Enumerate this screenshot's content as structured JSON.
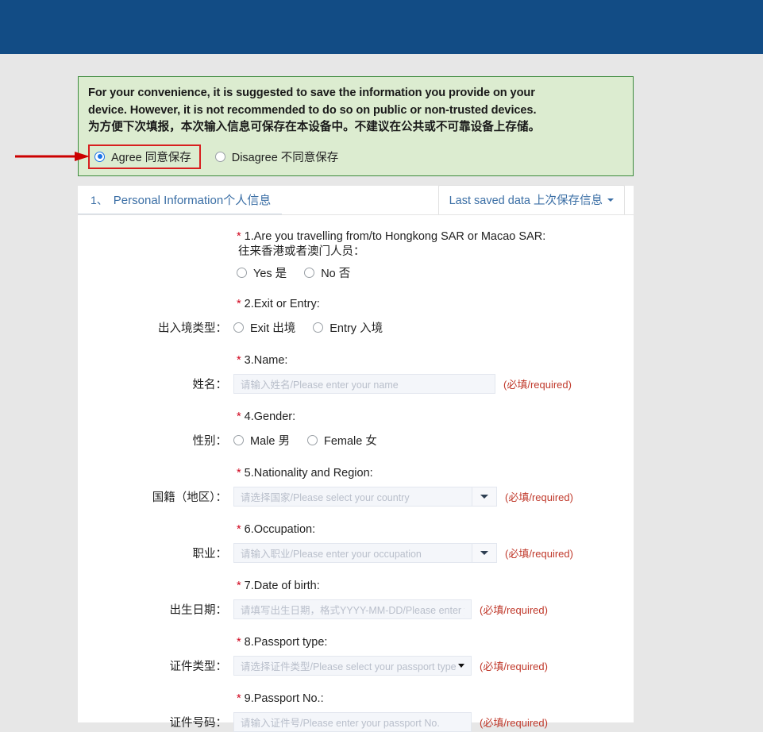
{
  "page": {
    "topbar_color": "#124c85",
    "background_color": "#e7e7e7"
  },
  "notice": {
    "line1_en": "For your convenience, it is suggested to save the information you provide on your",
    "line2_en": "device. However, it is not recommended to do so on public or non-trusted devices.",
    "line3_cn": "为方便下次填报，本次输入信息可保存在本设备中。不建议在公共或不可靠设备上存储。",
    "agree_label": "Agree 同意保存",
    "disagree_label": "Disagree 不同意保存",
    "agree_selected": true,
    "highlight_color": "#d81f1f",
    "box_bg": "#dcecd0",
    "box_border": "#3d8b3d"
  },
  "annotations": {
    "arrow_color": "#cc0000",
    "horizontal_arrow_target": "Agree 同意保存",
    "vertical_arrow_target": "form questions"
  },
  "panel": {
    "tab_number": "1、",
    "tab_label": "Personal Information个人信息",
    "last_saved_label": "Last saved data 上次保存信息",
    "accent_color": "#3a6ea5"
  },
  "questions": [
    {
      "id": "q1",
      "title_en": "1.Are you travelling from/to Hongkong SAR or Macao SAR:",
      "title_cn": "往来香港或者澳门人员：",
      "required": true,
      "type": "radio",
      "options": [
        "Yes 是",
        "No 否"
      ],
      "selected": null
    },
    {
      "id": "q2",
      "title_en": "2.Exit or Entry:",
      "title_cn": null,
      "label_cn": "出入境类型：",
      "required": true,
      "type": "radio-inline",
      "options": [
        "Exit 出境",
        "Entry 入境"
      ],
      "selected": null
    },
    {
      "id": "q3",
      "title_en": "3.Name:",
      "label_cn": "姓名：",
      "required": true,
      "type": "text",
      "placeholder": "请输入姓名/Please enter your name",
      "value": "",
      "required_hint": "(必填/required)"
    },
    {
      "id": "q4",
      "title_en": "4.Gender:",
      "label_cn": "性别：",
      "required": true,
      "type": "radio-inline",
      "options": [
        "Male 男",
        "Female 女"
      ],
      "selected": null
    },
    {
      "id": "q5",
      "title_en": "5.Nationality and Region:",
      "label_cn": "国籍（地区）：",
      "required": true,
      "type": "select",
      "placeholder": "请选择国家/Please select your country",
      "value": "",
      "required_hint": "(必填/required)"
    },
    {
      "id": "q6",
      "title_en": "6.Occupation:",
      "label_cn": "职业：",
      "required": true,
      "type": "select",
      "placeholder": "请输入职业/Please enter your occupation",
      "value": "",
      "required_hint": "(必填/required)"
    },
    {
      "id": "q7",
      "title_en": "7.Date of birth:",
      "label_cn": "出生日期：",
      "required": true,
      "type": "text",
      "placeholder": "请填写出生日期，格式YYYY-MM-DD/Please enter your",
      "value": "",
      "required_hint": "(必填/required)"
    },
    {
      "id": "q8",
      "title_en": "8.Passport type:",
      "label_cn": "证件类型：",
      "required": true,
      "type": "select-inline",
      "placeholder": "请选择证件类型/Please select your passport type",
      "value": "",
      "required_hint": "(必填/required)"
    },
    {
      "id": "q9",
      "title_en": "9.Passport No.:",
      "label_cn": "证件号码：",
      "required": true,
      "type": "text",
      "placeholder": "请输入证件号/Please enter your passport No.",
      "value": "",
      "required_hint": "(必填/required)"
    }
  ],
  "symbols": {
    "required_star": "*",
    "caret_down": "▼"
  }
}
